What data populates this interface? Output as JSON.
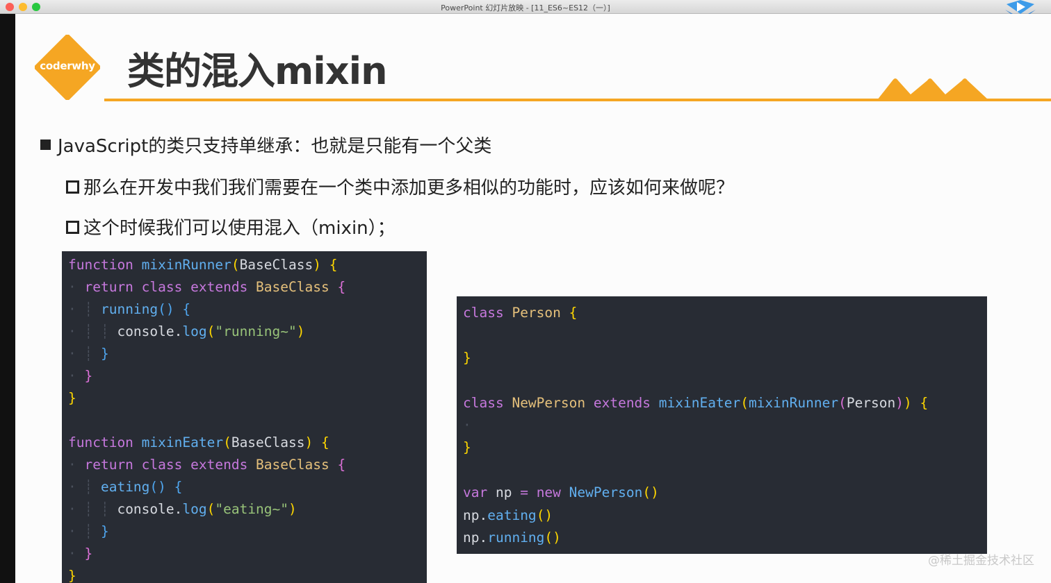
{
  "window": {
    "title": "PowerPoint 幻灯片放映 - [11_ES6~ES12（一）]"
  },
  "slide": {
    "logo_text": "coderwhy",
    "title": "类的混入mixin",
    "bullets": [
      "JavaScript的类只支持单继承：也就是只能有一个父类",
      "那么在开发中我们我们需要在一个类中添加更多相似的功能时，应该如何来做呢？",
      "这个时候我们可以使用混入（mixin）；"
    ]
  },
  "code_left": {
    "lines": [
      [
        [
          "kw",
          "function "
        ],
        [
          "fn",
          "mixinRunner"
        ],
        [
          "br1",
          "("
        ],
        [
          "plain",
          "BaseClass"
        ],
        [
          "br1",
          ")"
        ],
        [
          "plain",
          " "
        ],
        [
          "br1",
          "{"
        ]
      ],
      [
        [
          "guide",
          "· "
        ],
        [
          "kw",
          "return "
        ],
        [
          "kw",
          "class "
        ],
        [
          "kw",
          "extends "
        ],
        [
          "cls",
          "BaseClass "
        ],
        [
          "br2",
          "{"
        ]
      ],
      [
        [
          "guide",
          "· ┊ "
        ],
        [
          "fn",
          "running"
        ],
        [
          "br3",
          "()"
        ],
        [
          "plain",
          " "
        ],
        [
          "br3",
          "{"
        ]
      ],
      [
        [
          "guide",
          "· ┊ ┊ "
        ],
        [
          "plain",
          "console."
        ],
        [
          "fn",
          "log"
        ],
        [
          "br1",
          "("
        ],
        [
          "str",
          "\"running~\""
        ],
        [
          "br1",
          ")"
        ]
      ],
      [
        [
          "guide",
          "· ┊ "
        ],
        [
          "br3",
          "}"
        ]
      ],
      [
        [
          "guide",
          "· "
        ],
        [
          "br2",
          "}"
        ]
      ],
      [
        [
          "br1",
          "}"
        ]
      ],
      [
        [
          "plain",
          ""
        ]
      ],
      [
        [
          "kw",
          "function "
        ],
        [
          "fn",
          "mixinEater"
        ],
        [
          "br1",
          "("
        ],
        [
          "plain",
          "BaseClass"
        ],
        [
          "br1",
          ")"
        ],
        [
          "plain",
          " "
        ],
        [
          "br1",
          "{"
        ]
      ],
      [
        [
          "guide",
          "· "
        ],
        [
          "kw",
          "return "
        ],
        [
          "kw",
          "class "
        ],
        [
          "kw",
          "extends "
        ],
        [
          "cls",
          "BaseClass "
        ],
        [
          "br2",
          "{"
        ]
      ],
      [
        [
          "guide",
          "· ┊ "
        ],
        [
          "fn",
          "eating"
        ],
        [
          "br3",
          "()"
        ],
        [
          "plain",
          " "
        ],
        [
          "br3",
          "{"
        ]
      ],
      [
        [
          "guide",
          "· ┊ ┊ "
        ],
        [
          "plain",
          "console."
        ],
        [
          "fn",
          "log"
        ],
        [
          "br1",
          "("
        ],
        [
          "str",
          "\"eating~\""
        ],
        [
          "br1",
          ")"
        ]
      ],
      [
        [
          "guide",
          "· ┊ "
        ],
        [
          "br3",
          "}"
        ]
      ],
      [
        [
          "guide",
          "· "
        ],
        [
          "br2",
          "}"
        ]
      ],
      [
        [
          "br1",
          "}"
        ]
      ]
    ]
  },
  "code_right": {
    "lines": [
      [
        [
          "kw",
          "class "
        ],
        [
          "cls",
          "Person "
        ],
        [
          "br1",
          "{"
        ]
      ],
      [
        [
          "plain",
          ""
        ]
      ],
      [
        [
          "br1",
          "}"
        ]
      ],
      [
        [
          "plain",
          ""
        ]
      ],
      [
        [
          "kw",
          "class "
        ],
        [
          "cls",
          "NewPerson "
        ],
        [
          "kw",
          "extends "
        ],
        [
          "fn",
          "mixinEater"
        ],
        [
          "br1",
          "("
        ],
        [
          "fn",
          "mixinRunner"
        ],
        [
          "br2",
          "("
        ],
        [
          "plain",
          "Person"
        ],
        [
          "br2",
          ")"
        ],
        [
          "br1",
          ")"
        ],
        [
          "plain",
          " "
        ],
        [
          "br1",
          "{"
        ]
      ],
      [
        [
          "guide",
          "·"
        ]
      ],
      [
        [
          "br1",
          "}"
        ]
      ],
      [
        [
          "plain",
          ""
        ]
      ],
      [
        [
          "kw",
          "var "
        ],
        [
          "plain",
          "np "
        ],
        [
          "kw",
          "= "
        ],
        [
          "kw",
          "new "
        ],
        [
          "fn",
          "NewPerson"
        ],
        [
          "br1",
          "()"
        ]
      ],
      [
        [
          "plain",
          "np."
        ],
        [
          "fn",
          "eating"
        ],
        [
          "br1",
          "()"
        ]
      ],
      [
        [
          "plain",
          "np."
        ],
        [
          "fn",
          "running"
        ],
        [
          "br1",
          "()"
        ]
      ]
    ]
  },
  "watermark": "@稀土掘金技术社区",
  "colors": {
    "accent": "#f5a623",
    "code_bg": "#282c34",
    "keyword": "#c678dd",
    "function": "#61afef",
    "class": "#e5c07b",
    "string": "#98c379"
  }
}
